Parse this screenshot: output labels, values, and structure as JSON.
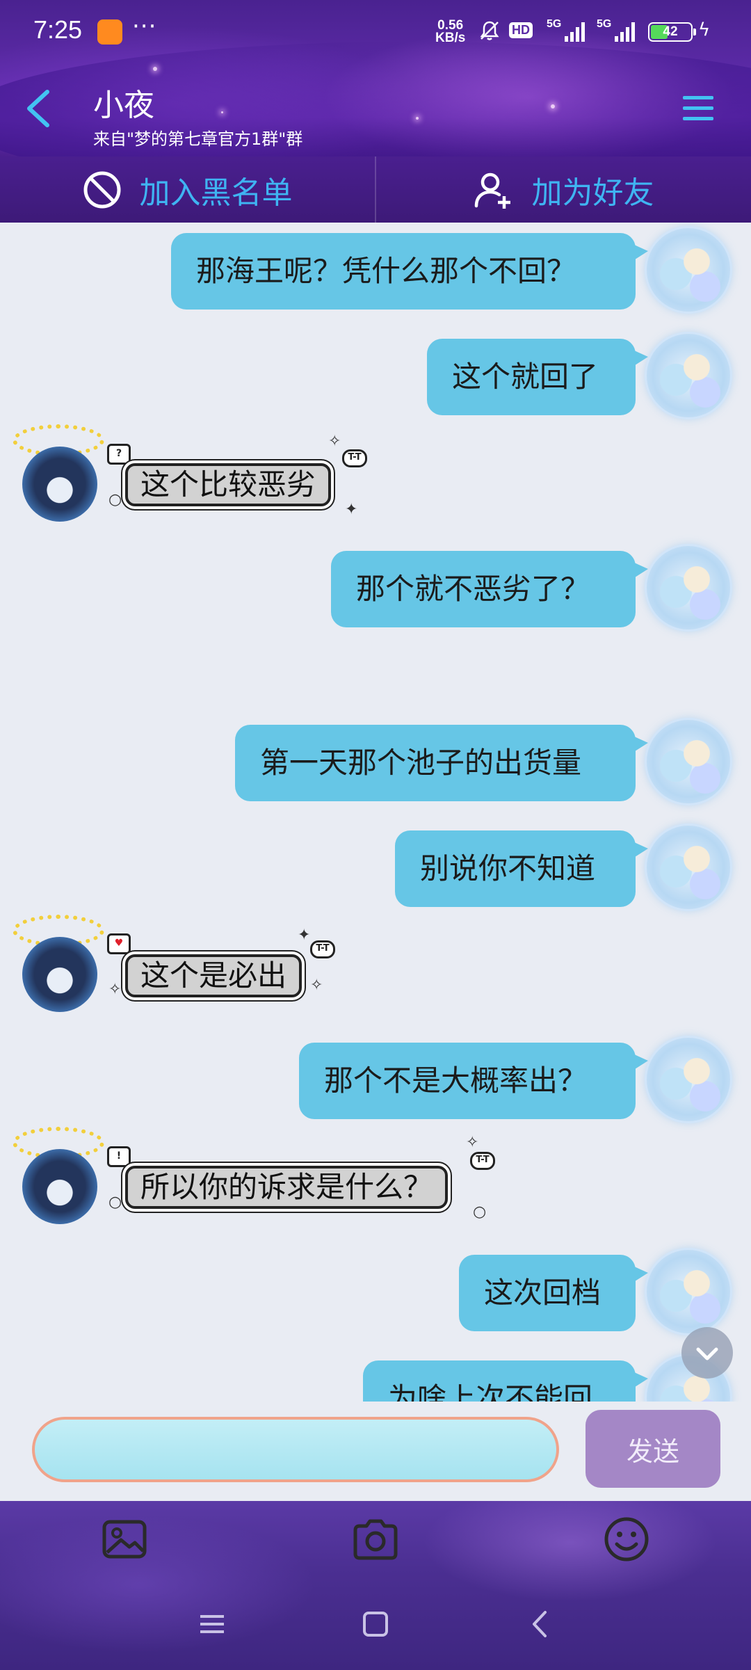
{
  "status_bar": {
    "time": "7:25",
    "app_badge": "",
    "more": "···",
    "net_speed_value": "0.56",
    "net_speed_unit": "KB/s",
    "hd": "HD",
    "sim1": "5G",
    "sim2": "5G",
    "battery": "42"
  },
  "header": {
    "title": "小夜",
    "subtitle": "来自\"梦的第七章官方1群\"群"
  },
  "actions": {
    "blacklist": "加入黑名单",
    "add_friend": "加为好友"
  },
  "messages": [
    {
      "side": "right",
      "text": "那海王呢？凭什么那个不回？"
    },
    {
      "side": "right",
      "text": "这个就回了"
    },
    {
      "side": "left",
      "text": "这个比较恶劣"
    },
    {
      "side": "right",
      "text": "那个就不恶劣了？"
    },
    {
      "side": "right",
      "text": "第一天那个池子的出货量"
    },
    {
      "side": "right",
      "text": "别说你不知道"
    },
    {
      "side": "left",
      "text": "这个是必出"
    },
    {
      "side": "right",
      "text": "那个不是大概率出？"
    },
    {
      "side": "left",
      "text": "所以你的诉求是什么？"
    },
    {
      "side": "right",
      "text": "这次回档"
    },
    {
      "side": "right",
      "text": "为啥上次不能回"
    }
  ],
  "input": {
    "value": "",
    "placeholder": "",
    "send_label": "发送"
  },
  "colors": {
    "accent": "#3fb4f2",
    "bubble_out": "#66c6e6",
    "header_purple": "#5b2aa6",
    "send_button": "#a487c6"
  },
  "icons": {
    "back": "back-arrow-icon",
    "menu": "menu-icon",
    "blacklist": "block-icon",
    "add_friend": "add-user-icon",
    "image": "image-icon",
    "camera": "camera-icon",
    "emoji": "emoji-icon",
    "scroll_down": "chevron-down-icon"
  }
}
